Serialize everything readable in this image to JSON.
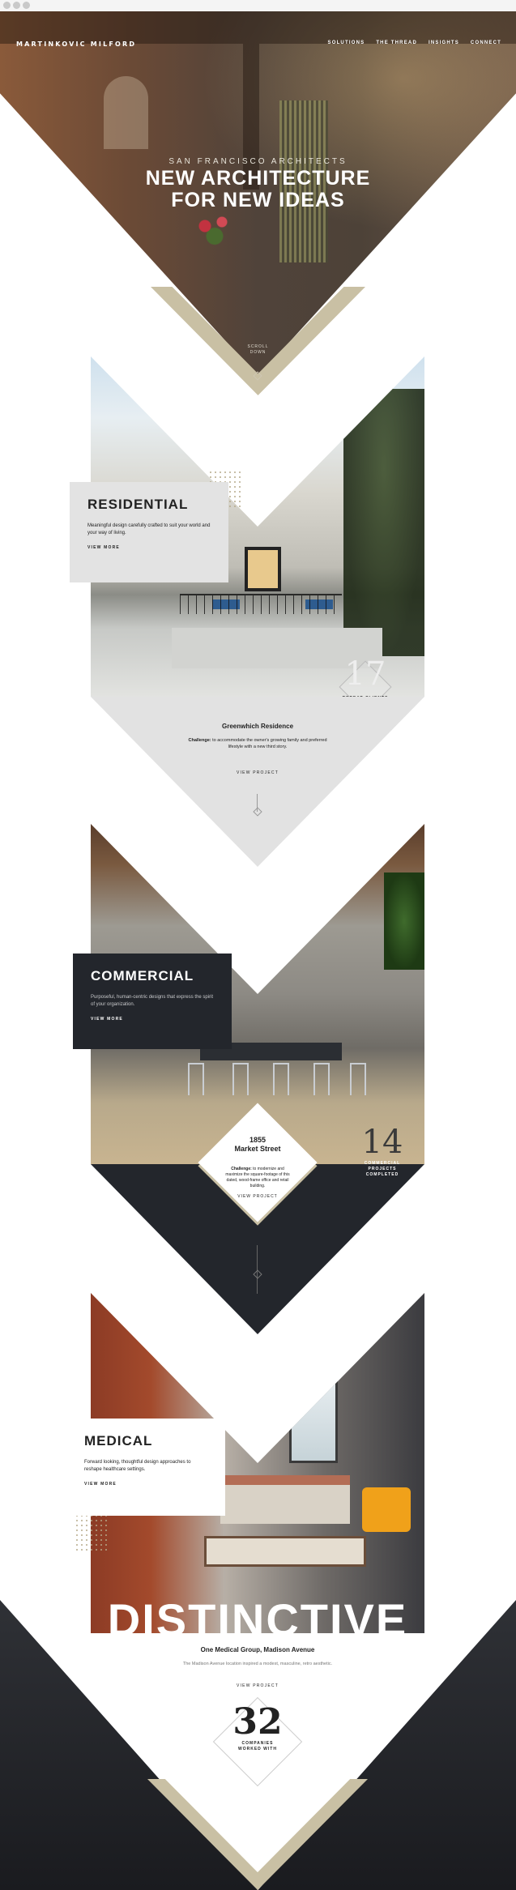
{
  "site": {
    "logo": "MARTINKOVIC MILFORD",
    "nav": [
      "SOLUTIONS",
      "THE THREAD",
      "INSIGHTS",
      "CONNECT"
    ]
  },
  "hero": {
    "subtitle": "SAN FRANCISCO ARCHITECTS",
    "title_line1": "NEW ARCHITECTURE",
    "title_line2": "FOR NEW IDEAS",
    "scroll_line1": "SCROLL",
    "scroll_line2": "DOWN"
  },
  "residential": {
    "heading": "RESIDENTIAL",
    "description": "Meaningful design carefully crafted to suit your world and your way of living.",
    "cta": "VIEW MORE",
    "stat_number": "17",
    "stat_label": "REPEAT CLIENTS",
    "project_title": "Greenwhich Residence",
    "challenge_label": "Challenge:",
    "challenge_text": " to accommodate the owner's growing family and preferred lifestyle with a new third story.",
    "project_cta": "VIEW PROJECT"
  },
  "commercial": {
    "heading": "COMMERCIAL",
    "description": "Purposeful, human-centric designs that express the spirit of your organization.",
    "cta": "VIEW MORE",
    "project_title_line1": "1855",
    "project_title_line2": "Market Street",
    "challenge_label": "Challenge:",
    "challenge_text": " to modernize and maximize the square-footage of this dated, wood-frame office and retail building.",
    "project_cta": "VIEW PROJECT",
    "stat_number": "14",
    "stat_label_line1": "COMMERCIAL",
    "stat_label_line2": "PROJECTS",
    "stat_label_line3": "COMPLETED"
  },
  "medical": {
    "heading": "MEDICAL",
    "description": "Forward looking, thoughtful design approaches to reshape healthcare settings.",
    "cta": "VIEW MORE",
    "big_word": "DISTINCTIVE",
    "project_title": "One Medical Group, Madison Avenue",
    "project_text": "The Madison Avenue location inspired a modest, masculine, retro aesthetic.",
    "project_cta": "VIEW PROJECT",
    "stat_number": "32",
    "stat_label_line1": "COMPANIES",
    "stat_label_line2": "WORKED WITH"
  },
  "colors": {
    "gold": "#c9c0a4",
    "dark": "#23262c",
    "light_gray": "#e3e3e3"
  }
}
